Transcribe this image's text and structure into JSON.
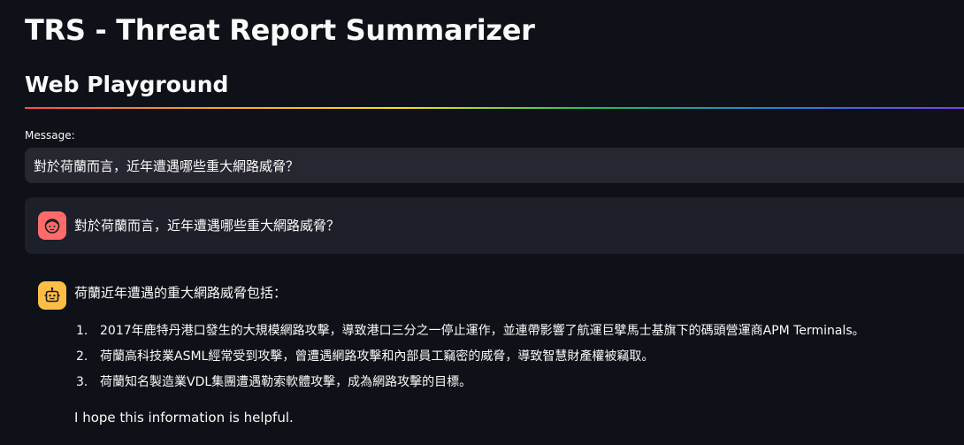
{
  "header": {
    "title": "TRS - Threat Report Summarizer",
    "subtitle": "Web Playground"
  },
  "input": {
    "label": "Message:",
    "value": "對於荷蘭而言，近年遭遇哪些重大網路威脅？"
  },
  "chat": {
    "user_message": "對於荷蘭而言，近年遭遇哪些重大網路威脅？",
    "assistant_intro": "荷蘭近年遭遇的重大網路威脅包括：",
    "assistant_items": [
      {
        "num": "1.",
        "text": "2017年鹿特丹港口發生的大規模網路攻擊，導致港口三分之一停止運作，並連帶影響了航運巨擘馬士基旗下的碼頭營運商APM Terminals。"
      },
      {
        "num": "2.",
        "text": "荷蘭高科技業ASML經常受到攻擊，曾遭遇網路攻擊和內部員工竊密的威脅，導致智慧財產權被竊取。"
      },
      {
        "num": "3.",
        "text": "荷蘭知名製造業VDL集團遭遇勒索軟體攻擊，成為網路攻擊的目標。"
      }
    ],
    "assistant_footer": "I hope this information is helpful."
  },
  "icons": {
    "user_avatar": "face-icon",
    "assistant_avatar": "robot-icon"
  },
  "colors": {
    "background": "#0e1117",
    "input_background": "#262730",
    "user_avatar": "#ff6b6b",
    "assistant_avatar": "#ffbd45"
  }
}
